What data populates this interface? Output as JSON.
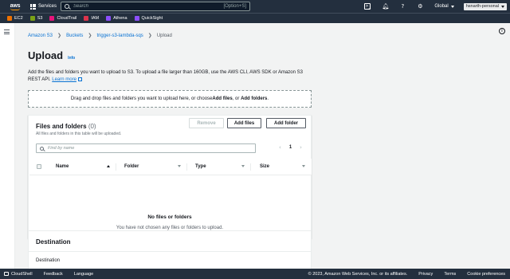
{
  "topnav": {
    "logo": "aws",
    "services_label": "Services",
    "search_placeholder": "Search",
    "search_shortcut": "[Option+S]",
    "region": "Global",
    "account": "hsnarth-personal"
  },
  "favorites": [
    {
      "label": "EC2",
      "color": "#ed7100"
    },
    {
      "label": "S3",
      "color": "#7aa116"
    },
    {
      "label": "CloudTrail",
      "color": "#e7157b"
    },
    {
      "label": "IAM",
      "color": "#dd344c"
    },
    {
      "label": "Athena",
      "color": "#8c4fff"
    },
    {
      "label": "QuickSight",
      "color": "#8c4fff"
    }
  ],
  "breadcrumb": {
    "items": [
      "Amazon S3",
      "Buckets",
      "trigger-s3-lambda-sqs"
    ],
    "current": "Upload"
  },
  "page": {
    "title": "Upload",
    "info": "Info",
    "description": "Add the files and folders you want to upload to S3. To upload a file larger than 160GB, use the AWS CLI, AWS SDK or Amazon S3 REST API.",
    "learn_more": "Learn more"
  },
  "dropzone": {
    "prefix": "Drag and drop files and folders you want to upload here, or choose ",
    "add_files": "Add files",
    "middle": ", or ",
    "add_folders": "Add folders",
    "suffix": "."
  },
  "files_panel": {
    "title": "Files and folders",
    "count": "(0)",
    "subtitle": "All files and folders in this table will be uploaded.",
    "remove": "Remove",
    "add_files": "Add files",
    "add_folder": "Add folder",
    "filter_placeholder": "Find by name",
    "page": "1",
    "columns": [
      "Name",
      "Folder",
      "Type",
      "Size"
    ],
    "empty_title": "No files or folders",
    "empty_sub": "You have not chosen any files or folders to upload."
  },
  "destination": {
    "title": "Destination",
    "label": "Destination"
  },
  "footer": {
    "cloudshell": "CloudShell",
    "feedback": "Feedback",
    "language": "Language",
    "copyright": "© 2023, Amazon Web Services, Inc. or its affiliates.",
    "privacy": "Privacy",
    "terms": "Terms",
    "cookies": "Cookie preferences"
  }
}
